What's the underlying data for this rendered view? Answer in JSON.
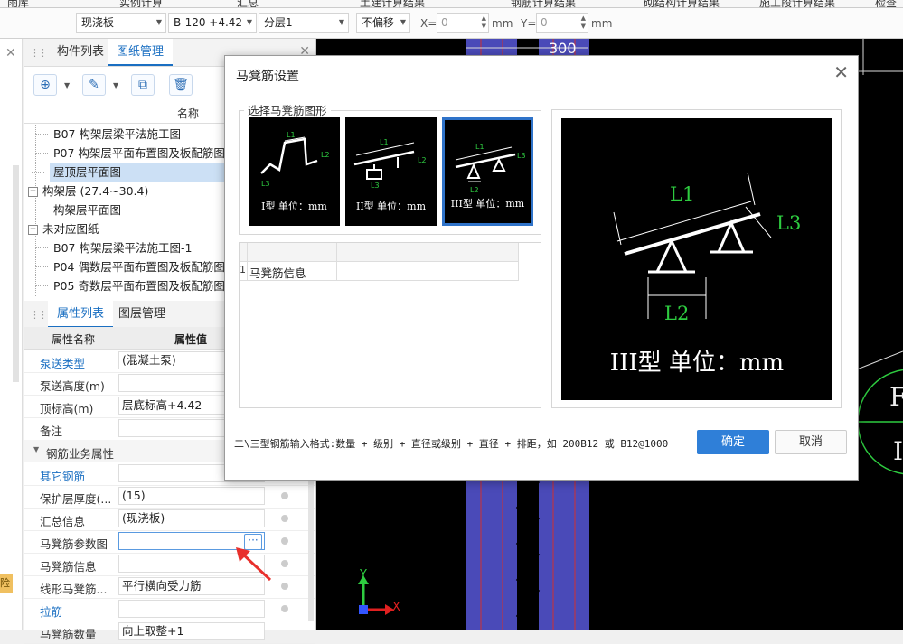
{
  "ribbon": {
    "items": [
      "雨库",
      "实例计算",
      "汇总",
      "土建计算结果",
      "钢筋计算结果",
      "砌结构计算结果",
      "施工段计算结果",
      "检查"
    ]
  },
  "toolbar": {
    "type_select": "现浇板",
    "component_select": "B-120 +4.42",
    "layer_select": "分层1",
    "offset_select": "不偏移",
    "x_label": "X=",
    "x_value": "0",
    "x_unit": "mm",
    "y_label": "Y=",
    "y_value": "0",
    "y_unit": "mm"
  },
  "drawing_panel": {
    "tabs": [
      "构件列表",
      "图纸管理"
    ],
    "active_tab": "图纸管理",
    "column_header": "名称",
    "tree": [
      {
        "label": "B07 构架层梁平法施工图",
        "level": 2,
        "selected": false
      },
      {
        "label": "P07 构架层平面布置图及板配筋图",
        "level": 2,
        "selected": false
      },
      {
        "label": "屋顶层平面图",
        "level": 2,
        "selected": true
      },
      {
        "label": "构架层 (27.4~30.4)",
        "level": 1,
        "expander": "−",
        "selected": false
      },
      {
        "label": "构架层平面图",
        "level": 2,
        "selected": false
      },
      {
        "label": "未对应图纸",
        "level": 1,
        "expander": "−",
        "selected": false
      },
      {
        "label": "B07 构架层梁平法施工图-1",
        "level": 2,
        "selected": false
      },
      {
        "label": "P04 偶数层平面布置图及板配筋图-",
        "level": 2,
        "selected": false
      },
      {
        "label": "P05 奇数层平面布置图及板配筋图",
        "level": 2,
        "selected": false
      }
    ]
  },
  "property_panel": {
    "tabs": [
      "属性列表",
      "图层管理"
    ],
    "active_tab": "属性列表",
    "col_name": "属性名称",
    "col_value": "属性值",
    "rows_top": [
      {
        "name": "泵送类型",
        "value": "(混凝土泵)",
        "blue": true
      },
      {
        "name": "泵送高度(m)",
        "value": "",
        "blue": false
      },
      {
        "name": "顶标高(m)",
        "value": "层底标高+4.42",
        "blue": false
      },
      {
        "name": "备注",
        "value": "",
        "blue": false
      }
    ],
    "group_label": "钢筋业务属性",
    "rows_bottom": [
      {
        "name": "其它钢筋",
        "value": "",
        "blue": true
      },
      {
        "name": "保护层厚度(...",
        "value": "(15)",
        "blue": false
      },
      {
        "name": "汇总信息",
        "value": "(现浇板)",
        "blue": false
      },
      {
        "name": "马凳筋参数图",
        "value": "",
        "blue": false,
        "ellipsis": "···"
      },
      {
        "name": "马凳筋信息",
        "value": "",
        "blue": false
      },
      {
        "name": "线形马凳筋...",
        "value": "平行横向受力筋",
        "blue": false
      },
      {
        "name": "拉筋",
        "value": "",
        "blue": true
      },
      {
        "name": "马凳筋数量",
        "value": "向上取整+1",
        "blue": false
      }
    ]
  },
  "left_strip": {
    "tag": "险"
  },
  "cad": {
    "dimension_label": "300",
    "axis_y": "Y",
    "axis_x": "X",
    "circle_label_1": "F",
    "circle_label_2": "I"
  },
  "dialog": {
    "title": "马凳筋设置",
    "group_legend": "选择马凳筋图形",
    "shapes": [
      {
        "caption": "I型 单位：mm",
        "selected": false
      },
      {
        "caption": "II型 单位：mm",
        "selected": false
      },
      {
        "caption": "III型 单位：mm",
        "selected": true
      }
    ],
    "grid": {
      "row_number": "1",
      "row_label": "马凳筋信息"
    },
    "preview": {
      "caption": "III型 单位：mm",
      "labels": {
        "l1": "L1",
        "l2": "L2",
        "l3": "L3"
      }
    },
    "hint": "二\\三型钢筋输入格式:数量 + 级别 + 直径或级别 + 直径 + 排距，如 200B12 或 B12@1000",
    "ok_label": "确定",
    "cancel_label": "取消"
  },
  "colors": {
    "accent": "#2f7fd8",
    "tab_active": "#1a6fc2",
    "cad_green": "#2ecc40",
    "column_blue": "#5a5ad8"
  }
}
